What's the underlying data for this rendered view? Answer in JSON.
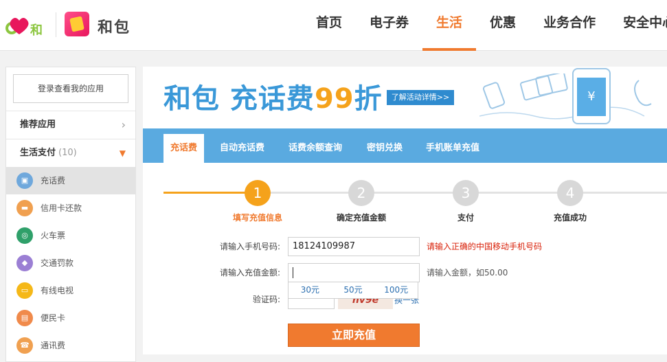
{
  "header": {
    "brand_name": "和包",
    "nav": [
      "首页",
      "电子券",
      "生活",
      "优惠",
      "业务合作",
      "安全中心"
    ],
    "active_nav": "生活"
  },
  "sidebar": {
    "login_label": "登录查看我的应用",
    "recommend_label": "推荐应用",
    "life_pay_label": "生活支付",
    "life_pay_count": "(10)",
    "items": [
      {
        "label": "充话费",
        "icon": "phone-bill-icon",
        "color": "#6fa8dc"
      },
      {
        "label": "信用卡还款",
        "icon": "credit-card-icon",
        "color": "#f0a050"
      },
      {
        "label": "火车票",
        "icon": "train-icon",
        "color": "#2fa06a"
      },
      {
        "label": "交通罚款",
        "icon": "car-icon",
        "color": "#9b7fd4"
      },
      {
        "label": "有线电视",
        "icon": "tv-icon",
        "color": "#f5b818"
      },
      {
        "label": "便民卡",
        "icon": "card-icon",
        "color": "#f08a4b"
      },
      {
        "label": "通讯费",
        "icon": "phone-icon",
        "color": "#f0a050"
      }
    ]
  },
  "banner": {
    "title_prefix": "和包 充话费",
    "title_highlight": "99",
    "title_suffix": "折",
    "button": "了解活动详情>>"
  },
  "tabs": [
    "充话费",
    "自动充话费",
    "话费余额查询",
    "密钥兑换",
    "手机账单充值"
  ],
  "steps": [
    {
      "num": "1",
      "label": "填写充值信息",
      "active": true
    },
    {
      "num": "2",
      "label": "确定充值金额",
      "active": false
    },
    {
      "num": "3",
      "label": "支付",
      "active": false
    },
    {
      "num": "4",
      "label": "充值成功",
      "active": false
    }
  ],
  "form": {
    "phone_label": "请输入手机号码:",
    "phone_value": "18124109987",
    "phone_error": "请输入正确的中国移动手机号码",
    "amount_label": "请输入充值金额:",
    "amount_hint": "请输入金额，如50.00",
    "amount_options": [
      "30元",
      "50元",
      "100元"
    ],
    "captcha_label": "验证码:",
    "captcha_text": "hv9e",
    "captcha_refresh": "换一张",
    "submit": "立即充值"
  }
}
